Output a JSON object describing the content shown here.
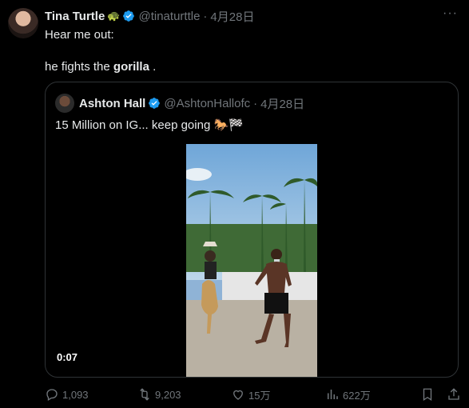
{
  "tweet": {
    "author_name": "Tina Turtle",
    "author_emoji": "🐢",
    "handle": "@tinaturttle",
    "separator": "·",
    "date": "4月28日",
    "line1": "Hear me out:",
    "line2_prefix": "he fights the ",
    "line2_bold": "gorilla",
    "line2_suffix": " ."
  },
  "quoted": {
    "author_name": "Ashton Hall",
    "handle": "@AshtonHallofc",
    "separator": "·",
    "date": "4月28日",
    "text": "15 Million on IG... keep going 🐎🏁",
    "video_time": "0:07"
  },
  "actions": {
    "replies": "1,093",
    "reposts": "9,203",
    "likes": "15万",
    "views": "622万"
  },
  "colors": {
    "verified": "#1d9bf0",
    "muted": "#71767b",
    "text": "#e7e9ea"
  }
}
